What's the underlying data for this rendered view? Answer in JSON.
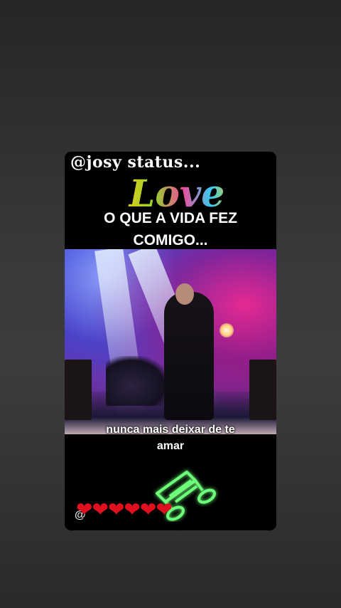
{
  "story": {
    "username": "@josy status...",
    "logo_text": "Love",
    "headline_line1": "O QUE A VIDA FEZ",
    "headline_line2": "COMIGO...",
    "subtitle_line1": "nunca mais deixar de te",
    "subtitle_line2": "amar",
    "watermark": "@",
    "hearts": [
      "heart-icon",
      "heart-icon",
      "heart-icon",
      "heart-icon",
      "heart-icon",
      "heart-icon"
    ]
  },
  "colors": {
    "background": "#333335",
    "card": "#000000",
    "heart": "#e0101e",
    "note_glow": "#4dff6a"
  }
}
